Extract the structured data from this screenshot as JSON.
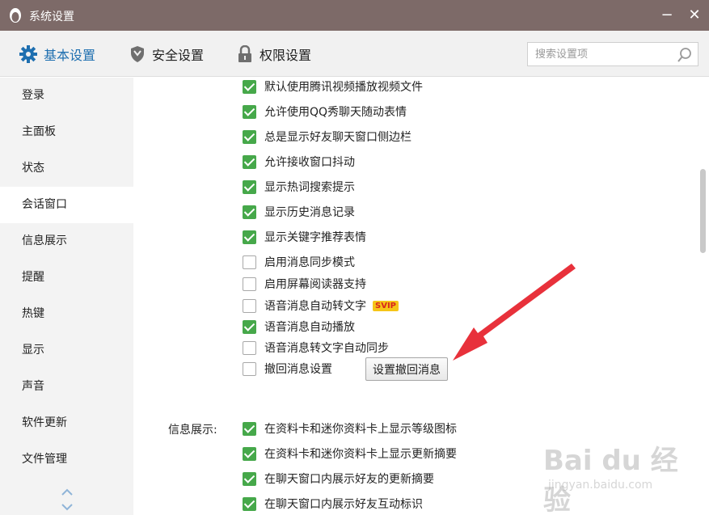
{
  "window": {
    "title": "系统设置",
    "minimize": "−",
    "close": "✕"
  },
  "tabs": [
    {
      "label": "基本设置",
      "icon": "gear-icon",
      "active": true
    },
    {
      "label": "安全设置",
      "icon": "shield-icon",
      "active": false
    },
    {
      "label": "权限设置",
      "icon": "lock-icon",
      "active": false
    }
  ],
  "search": {
    "placeholder": "搜索设置项"
  },
  "sidebar": {
    "items": [
      {
        "label": "登录"
      },
      {
        "label": "主面板"
      },
      {
        "label": "状态"
      },
      {
        "label": "会话窗口",
        "active": true
      },
      {
        "label": "信息展示"
      },
      {
        "label": "提醒"
      },
      {
        "label": "热键"
      },
      {
        "label": "显示"
      },
      {
        "label": "声音"
      },
      {
        "label": "软件更新"
      },
      {
        "label": "文件管理"
      }
    ]
  },
  "options": [
    {
      "label": "默认使用腾讯视频播放视频文件",
      "checked": true
    },
    {
      "label": "允许使用QQ秀聊天随动表情",
      "checked": true
    },
    {
      "label": "总是显示好友聊天窗口侧边栏",
      "checked": true
    },
    {
      "label": "允许接收窗口抖动",
      "checked": true
    },
    {
      "label": "显示热词搜索提示",
      "checked": true
    },
    {
      "label": "显示历史消息记录",
      "checked": true
    },
    {
      "label": "显示关键字推荐表情",
      "checked": true
    },
    {
      "label": "启用消息同步模式",
      "checked": false
    },
    {
      "label": "启用屏幕阅读器支持",
      "checked": false
    },
    {
      "label": "语音消息自动转文字",
      "checked": false,
      "badge": "SVIP"
    },
    {
      "label": "语音消息自动播放",
      "checked": true
    },
    {
      "label": "语音消息转文字自动同步",
      "checked": false
    },
    {
      "label": "撤回消息设置",
      "checked": false
    }
  ],
  "recall_button": "设置撤回消息",
  "info_section": {
    "label": "信息展示:",
    "options": [
      {
        "label": "在资料卡和迷你资料卡上显示等级图标",
        "checked": true
      },
      {
        "label": "在资料卡和迷你资料卡上显示更新摘要",
        "checked": true
      },
      {
        "label": "在聊天窗口内展示好友的更新摘要",
        "checked": true
      },
      {
        "label": "在聊天窗口内展示好友互动标识",
        "checked": true
      }
    ]
  },
  "watermark": {
    "logo": "Bai du 经验",
    "url": "jingyan.baidu.com"
  },
  "colors": {
    "titlebar": "#7d6a68",
    "accent": "#1e6fb0",
    "checkbox": "#46a84a",
    "arrow": "#e8313b"
  }
}
